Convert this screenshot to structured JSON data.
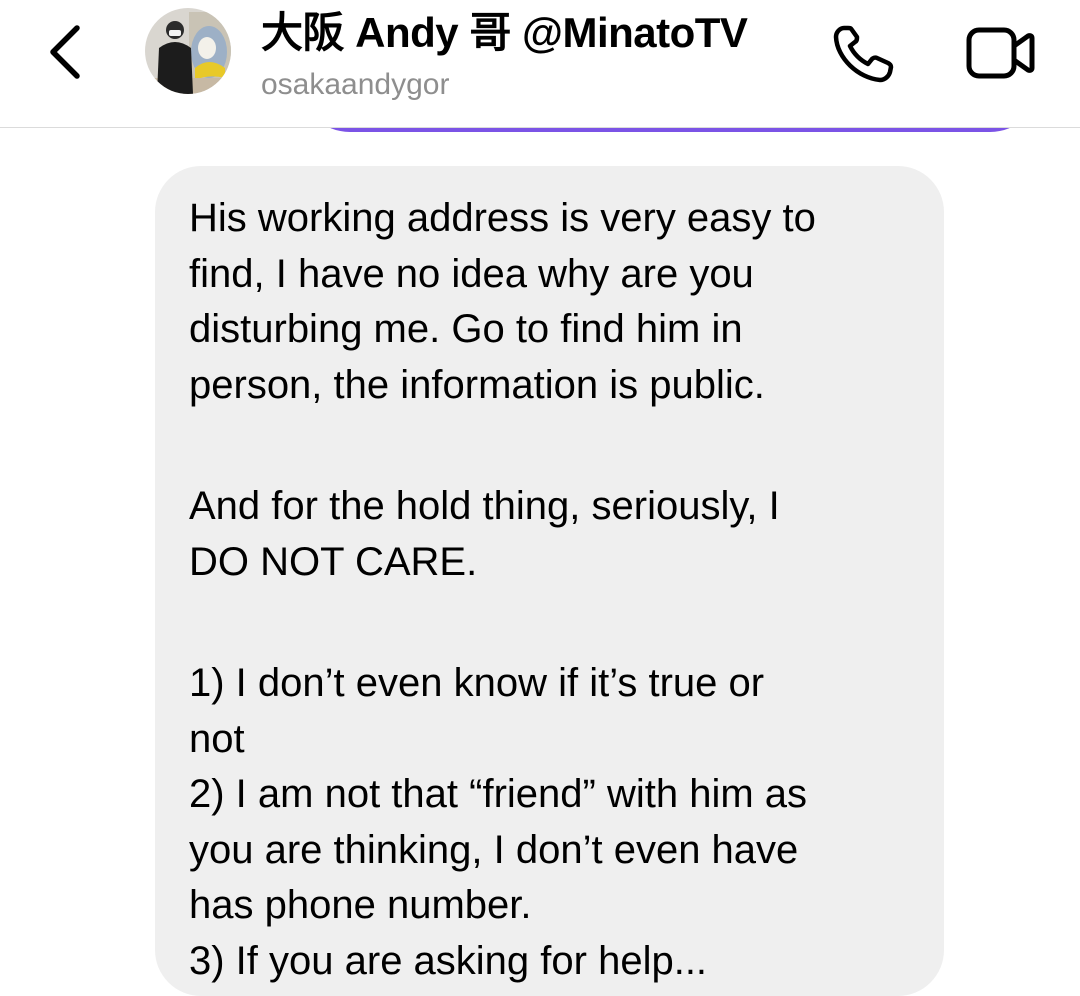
{
  "header": {
    "title": "大阪 Andy 哥 @MinatoTV",
    "username": "osakaandygor",
    "back_icon": "chevron-left-icon",
    "call_icon": "phone-icon",
    "video_icon": "video-camera-icon"
  },
  "colors": {
    "accent": "#7b53e6",
    "bubble_bg": "#efefef",
    "secondary_text": "#8e8e8e",
    "divider": "#dbdbdb"
  },
  "message": {
    "paragraph1": "His working address is very easy to\nfind, I have no idea why are you\ndisturbing me. Go to find him in\nperson, the information is public.",
    "paragraph2": "And for the hold thing, seriously, I\nDO NOT CARE.",
    "list_item1": "1) I don’t even know if it’s true or\nnot",
    "list_item2": "2) I am not that “friend” with him as\nyou are thinking, I don’t even have\nhas phone number.",
    "list_item3_partial": "3) If you are asking for help..."
  }
}
